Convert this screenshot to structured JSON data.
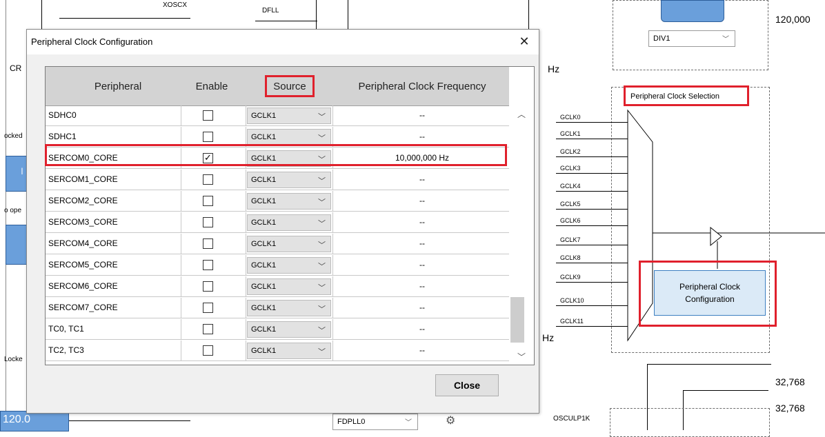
{
  "dialog": {
    "title": "Peripheral Clock Configuration",
    "close_x": "✕",
    "columns": [
      "Peripheral",
      "Enable",
      "Source",
      "Peripheral Clock Frequency"
    ],
    "rows": [
      {
        "name": "SDHC0",
        "enabled": false,
        "source": "GCLK1",
        "frequency": "--"
      },
      {
        "name": "SDHC1",
        "enabled": false,
        "source": "GCLK1",
        "frequency": "--"
      },
      {
        "name": "SERCOM0_CORE",
        "enabled": true,
        "source": "GCLK1",
        "frequency": "10,000,000 Hz"
      },
      {
        "name": "SERCOM1_CORE",
        "enabled": false,
        "source": "GCLK1",
        "frequency": "--"
      },
      {
        "name": "SERCOM2_CORE",
        "enabled": false,
        "source": "GCLK1",
        "frequency": "--"
      },
      {
        "name": "SERCOM3_CORE",
        "enabled": false,
        "source": "GCLK1",
        "frequency": "--"
      },
      {
        "name": "SERCOM4_CORE",
        "enabled": false,
        "source": "GCLK1",
        "frequency": "--"
      },
      {
        "name": "SERCOM5_CORE",
        "enabled": false,
        "source": "GCLK1",
        "frequency": "--"
      },
      {
        "name": "SERCOM6_CORE",
        "enabled": false,
        "source": "GCLK1",
        "frequency": "--"
      },
      {
        "name": "SERCOM7_CORE",
        "enabled": false,
        "source": "GCLK1",
        "frequency": "--"
      },
      {
        "name": "TC0, TC1",
        "enabled": false,
        "source": "GCLK1",
        "frequency": "--"
      },
      {
        "name": "TC2, TC3",
        "enabled": false,
        "source": "GCLK1",
        "frequency": "--"
      }
    ],
    "close_button": "Close"
  },
  "background": {
    "xosc_label": "XOSCX",
    "dfll_label": "DFLL",
    "freq_top_right": "120,000",
    "div_select": "DIV1",
    "hz_mid": "Hz",
    "hz_low": "Hz",
    "cr_label": "CR",
    "locked_1": "ocked",
    "locked_2": "Locke",
    "ope_label": "o ope",
    "i_label": "I",
    "bottom_left_value": "120.0",
    "fdpll_select": "FDPLL0",
    "periph_clock_selection": "Peripheral Clock Selection",
    "gclk_labels": [
      "GCLK0",
      "GCLK1",
      "GCLK2",
      "GCLK3",
      "GCLK4",
      "GCLK5",
      "GCLK6",
      "GCLK7",
      "GCLK8",
      "GCLK9",
      "GCLK10",
      "GCLK11"
    ],
    "config_button_line1": "Peripheral Clock",
    "config_button_line2": "Configuration",
    "freq_32k_1": "32,768",
    "freq_32k_2": "32,768",
    "osculp_label": "OSCULP1K",
    "gear_icon": "gear-icon"
  }
}
